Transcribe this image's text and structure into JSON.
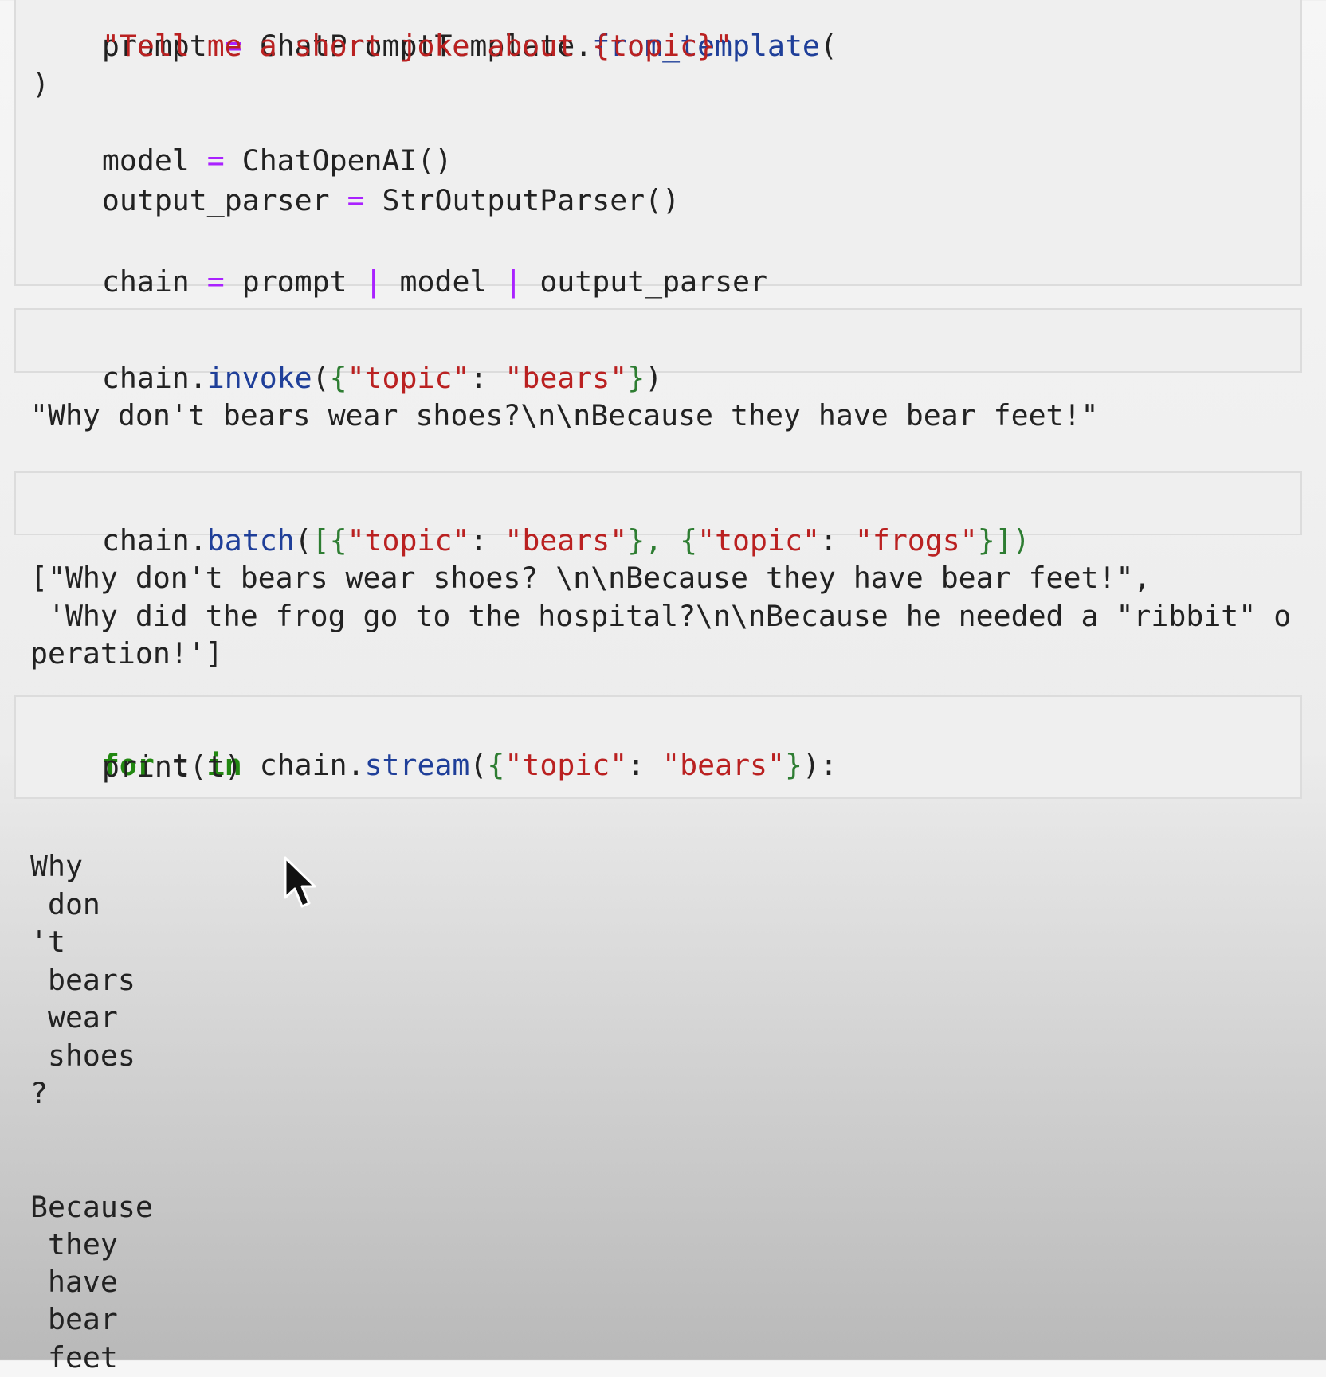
{
  "cells": {
    "cell1": {
      "line1": {
        "a": "prompt ",
        "b": "=",
        "c": " ChatPromptTemplate.",
        "d": "from_template",
        "e": "("
      },
      "line2": "    \"Tell me a short joke about {topic}\"",
      "line3": ")",
      "line4": {
        "a": "model ",
        "b": "=",
        "c": " ChatOpenAI()"
      },
      "line5": {
        "a": "output_parser ",
        "b": "=",
        "c": " StrOutputParser()"
      },
      "line6": {
        "a": "chain ",
        "b": "=",
        "c": " prompt ",
        "d": "|",
        "e": " model ",
        "f": "|",
        "g": " output_parser"
      }
    },
    "cell2": {
      "a": "chain.",
      "b": "invoke",
      "c": "(",
      "d": "{",
      "e": "\"topic\"",
      "f": ": ",
      "g": "\"bears\"",
      "h": "}",
      "i": ")"
    },
    "out2": "\"Why don't bears wear shoes?\\n\\nBecause they have bear feet!\"",
    "cell3": {
      "a": "chain.",
      "b": "batch",
      "c": "(",
      "d": "[{",
      "e": "\"topic\"",
      "f": ": ",
      "g": "\"bears\"",
      "h": "},",
      "i": " {",
      "j": "\"topic\"",
      "k": ": ",
      "l": "\"frogs\"",
      "m": "}])"
    },
    "out3": [
      "[\"Why don't bears wear shoes? \\n\\nBecause they have bear feet!\",",
      " 'Why did the frog go to the hospital?\\n\\nBecause he needed a \"ribbit\" o",
      "peration!']"
    ],
    "cell4": {
      "line1": {
        "a": "for",
        "b": " t ",
        "c": "in",
        "d": " chain.",
        "e": "stream",
        "f": "(",
        "g": "{",
        "h": "\"topic\"",
        "i": ": ",
        "j": "\"bears\"",
        "k": "}",
        "l": "):"
      },
      "line2": "    print(t)"
    },
    "out4": {
      "group1": [
        "Why",
        " don",
        "'t",
        " bears",
        " wear",
        " shoes",
        "?"
      ],
      "group2": [
        "Because",
        " they",
        " have",
        " bear",
        " feet"
      ]
    }
  },
  "icons": {
    "cursor": "mouse-pointer-icon"
  },
  "colors": {
    "keyword": "#228811",
    "operator": "#aa22ff",
    "function": "#1f3f99",
    "string": "#ba2121",
    "bracket": "#2e7d32"
  }
}
